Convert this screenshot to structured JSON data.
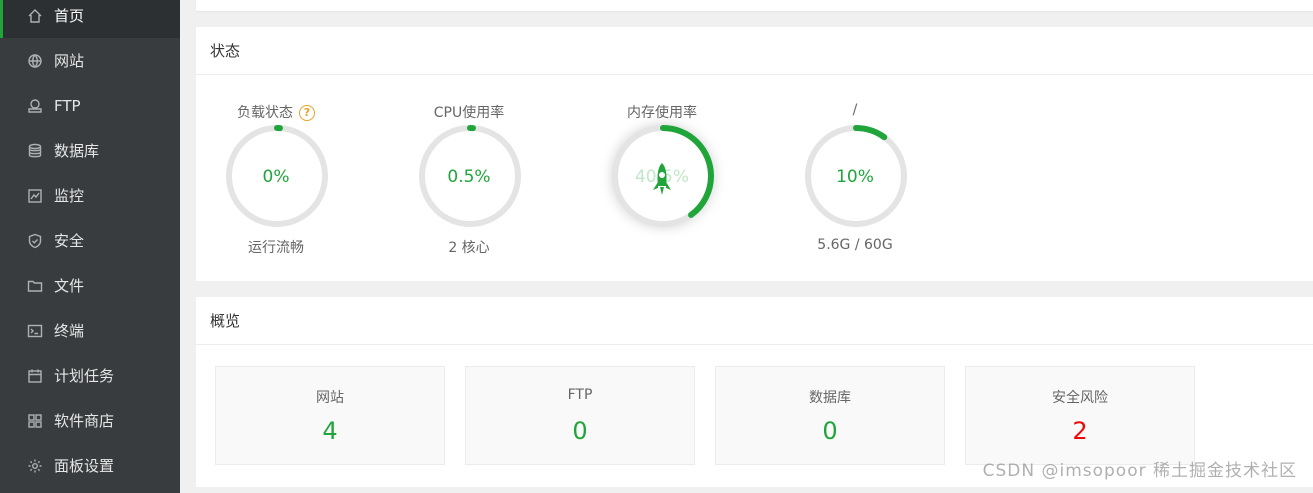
{
  "sidebar": {
    "items": [
      {
        "label": "首页",
        "icon": "home-icon",
        "active": true
      },
      {
        "label": "网站",
        "icon": "globe-icon"
      },
      {
        "label": "FTP",
        "icon": "ftp-icon"
      },
      {
        "label": "数据库",
        "icon": "database-icon"
      },
      {
        "label": "监控",
        "icon": "monitor-icon"
      },
      {
        "label": "安全",
        "icon": "shield-icon"
      },
      {
        "label": "文件",
        "icon": "folder-icon"
      },
      {
        "label": "终端",
        "icon": "terminal-icon"
      },
      {
        "label": "计划任务",
        "icon": "calendar-icon"
      },
      {
        "label": "软件商店",
        "icon": "grid-icon"
      },
      {
        "label": "面板设置",
        "icon": "gear-icon"
      }
    ]
  },
  "status": {
    "title": "状态",
    "gauges": [
      {
        "label": "负载状态",
        "value": "0%",
        "sub": "运行流畅",
        "fraction": 0.01,
        "help": "?"
      },
      {
        "label": "CPU使用率",
        "value": "0.5%",
        "sub": "2 核心",
        "fraction": 0.01
      },
      {
        "label": "内存使用率",
        "value": "40.5%",
        "sub": "",
        "fraction": 0.4,
        "overlay": "rocket-icon"
      },
      {
        "label": "/",
        "value": "10%",
        "sub": "5.6G / 60G",
        "fraction": 0.1
      }
    ]
  },
  "overview": {
    "title": "概览",
    "cards": [
      {
        "label": "网站",
        "value": "4"
      },
      {
        "label": "FTP",
        "value": "0"
      },
      {
        "label": "数据库",
        "value": "0"
      },
      {
        "label": "安全风险",
        "value": "2",
        "danger": true
      }
    ]
  },
  "watermark": "CSDN @imsopoor  稀土掘金技术社区",
  "colors": {
    "accent": "#20a53a",
    "danger": "#ef0808",
    "sidebar": "#383c3e",
    "help": "#e7a227"
  }
}
